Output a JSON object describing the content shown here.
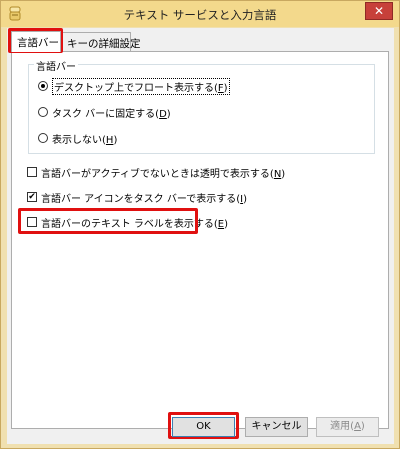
{
  "window": {
    "title": "テキスト サービスと入力言語",
    "close_glyph": "✕"
  },
  "tabs": [
    {
      "label": "言語バー",
      "active": true
    },
    {
      "label": "キーの詳細設定",
      "active": false
    }
  ],
  "language_bar_group": {
    "legend": "言語バー",
    "options": [
      {
        "label_pre": "デスクトップ上でフロート表示する(",
        "key": "F",
        "label_post": ")",
        "selected": true
      },
      {
        "label_pre": "タスク バーに固定する(",
        "key": "D",
        "label_post": ")",
        "selected": false
      },
      {
        "label_pre": "表示しない(",
        "key": "H",
        "label_post": ")",
        "selected": false
      }
    ]
  },
  "checkboxes": [
    {
      "label_pre": "言語バーがアクティブでないときは透明で表示する(",
      "key": "N",
      "label_post": ")",
      "checked": false
    },
    {
      "label_pre": "言語バー アイコンをタスク バーで表示する(",
      "key": "I",
      "label_post": ")",
      "checked": true
    },
    {
      "label_pre": "言語バーのテキスト ラベルを表示する(",
      "key": "E",
      "label_post": ")",
      "checked": false
    }
  ],
  "check_glyph": "✔",
  "buttons": {
    "ok": "OK",
    "cancel": "キャンセル",
    "apply_pre": "適用(",
    "apply_key": "A",
    "apply_post": ")"
  },
  "colors": {
    "highlight": "#e01010",
    "titlebar": "#f3d98c",
    "close_button": "#c7403a"
  }
}
